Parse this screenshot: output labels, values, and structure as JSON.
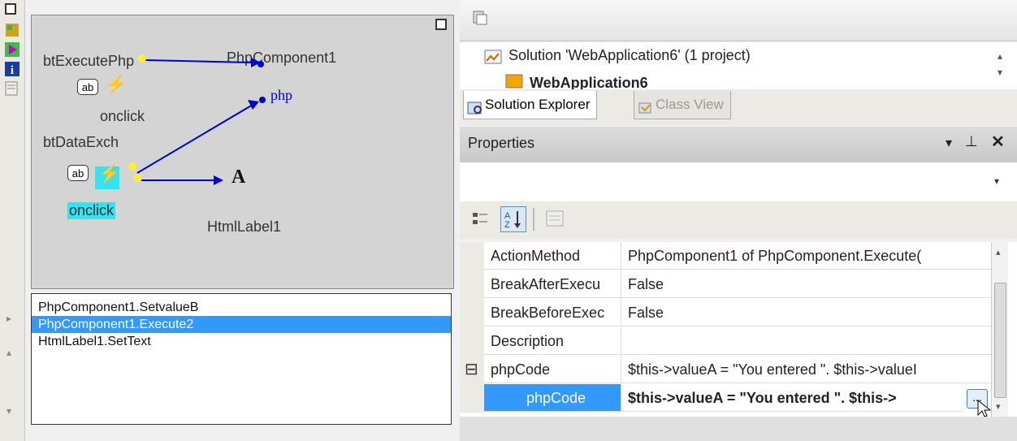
{
  "designer": {
    "bt_execute_label": "btExecutePhp",
    "php_component_label": "PhpComponent1",
    "ab_text": "ab",
    "onclick_label_1": "onclick",
    "php_text": "php",
    "bt_data_exch_label": "btDataExch",
    "onclick_label_2": "onclick",
    "a_text": "A",
    "html_label_name": "HtmlLabel1"
  },
  "method_list": {
    "items": [
      "PhpComponent1.SetvalueB",
      "PhpComponent1.Execute2",
      "HtmlLabel1.SetText"
    ]
  },
  "solution": {
    "line1": "Solution 'WebApplication6' (1 project)",
    "line2": "WebApplication6"
  },
  "tabs": {
    "solution_explorer": "Solution Explorer",
    "class_view": "Class View"
  },
  "properties": {
    "title": "Properties",
    "rows": [
      {
        "name": "ActionMethod",
        "value": "PhpComponent1 of PhpComponent.Execute("
      },
      {
        "name": "BreakAfterExecu",
        "value": "False"
      },
      {
        "name": "BreakBeforeExec",
        "value": "False"
      },
      {
        "name": "Description",
        "value": ""
      },
      {
        "name": "phpCode",
        "value": "$this->valueA = \"You entered \". $this->valueI"
      },
      {
        "name": "phpCode",
        "value": "$this->valueA = \"You entered \". $this->"
      }
    ],
    "expander": "⊟",
    "ellipsis": "..."
  },
  "colors": {
    "selection": "#3399ff",
    "link_blue": "#0000cc",
    "highlight_cyan": "#33e3f0"
  }
}
